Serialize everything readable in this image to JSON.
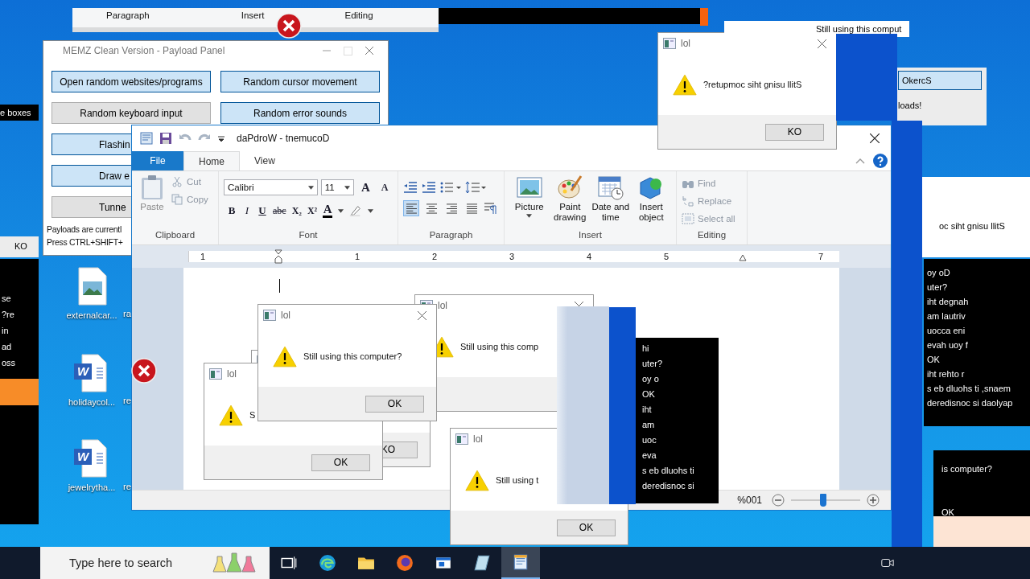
{
  "desktop_icons": [
    {
      "label": "externalcar...",
      "kind": "image"
    },
    {
      "label": "holidaycol...",
      "kind": "word",
      "badge": "W"
    },
    {
      "label": "jewelrytha...",
      "kind": "word",
      "badge": "W"
    }
  ],
  "desktop_label_fragments": [
    "ra",
    "re",
    "re"
  ],
  "memz_panel": {
    "title": "MEMZ Clean Version - Payload Panel",
    "buttons": [
      {
        "label": "Open random websites/programs",
        "on": true
      },
      {
        "label": "Random cursor movement",
        "on": true
      },
      {
        "label": "Random keyboard input",
        "on": false
      },
      {
        "label": "Random error sounds",
        "on": true
      }
    ],
    "partial_buttons": [
      {
        "label": "Flashin",
        "on": true
      },
      {
        "label": "Draw e",
        "on": true
      },
      {
        "label": "Tunne",
        "on": false
      }
    ],
    "status_lines": [
      "Payloads are currentl",
      "Press CTRL+SHIFT+"
    ]
  },
  "wordpad": {
    "title": "daPdroW - tnemucoD",
    "tabs": [
      {
        "label": "File",
        "kind": "file",
        "selected": false
      },
      {
        "label": "Home",
        "kind": "tab",
        "selected": true
      },
      {
        "label": "View",
        "kind": "tab",
        "selected": false
      }
    ],
    "clipboard": {
      "label": "Clipboard",
      "paste": "Paste",
      "small": [
        "Cut",
        "Copy"
      ]
    },
    "font": {
      "label": "Font",
      "family": "Calibri",
      "size": "11",
      "size_buttons": [
        "A",
        "A"
      ],
      "format_buttons": [
        "B",
        "I",
        "U",
        "abc",
        "X₂",
        "X²"
      ],
      "color_glyph": "A"
    },
    "paragraph": {
      "label": "Paragraph",
      "alignments": [
        {
          "selected": true
        },
        {
          "selected": false
        },
        {
          "selected": false
        },
        {
          "selected": false
        }
      ]
    },
    "insert": {
      "label": "Insert",
      "items": [
        {
          "label": "Picture",
          "kind": "picture"
        },
        {
          "label": "Paint drawing",
          "kind": "paint"
        },
        {
          "label": "Date and time",
          "kind": "date"
        },
        {
          "label": "Insert object",
          "kind": "object"
        }
      ]
    },
    "editing": {
      "label": "Editing",
      "items": [
        {
          "label": "Find",
          "kind": "find"
        },
        {
          "label": "Replace",
          "kind": "replace"
        },
        {
          "label": "Select all",
          "kind": "select"
        }
      ]
    },
    "ruler_numbers": [
      "1",
      "1",
      "2",
      "3",
      "4",
      "5",
      "7"
    ],
    "zoom_reading": "%001",
    "zoom": {
      "level": 0.47
    }
  },
  "dialogs": [
    {
      "title": "lol",
      "message": "Still using this comp"
    },
    {
      "button": "KO"
    },
    {
      "title": "lol",
      "message": "S",
      "button": "OK"
    },
    {
      "title": "lol",
      "message": "Still using this computer?",
      "button": "OK"
    },
    {
      "title": "lol",
      "message": "Still using t",
      "button": "OK"
    },
    {
      "title": "lol",
      "message": "?retupmoc siht gnisu llitS",
      "button": "KO"
    }
  ],
  "glitch_fragments": [
    {
      "kind": "ribbon",
      "lines": [
        "Paragraph",
        "Insert",
        "Editing"
      ]
    },
    {
      "kind": "white",
      "lines": [
        "Still using this comput"
      ]
    },
    {
      "kind": "dark",
      "lines": [
        "e boxes"
      ]
    },
    {
      "kind": "light",
      "lines": [
        "KO"
      ]
    },
    {
      "kind": "dark",
      "lines": [
        "se",
        "?re",
        "in",
        "ad",
        "oss"
      ]
    },
    {
      "kind": "light",
      "lines": [
        "OkercS",
        "loads!"
      ]
    },
    {
      "kind": "white",
      "lines": [
        "oc siht gnisu llitS"
      ]
    },
    {
      "kind": "dark",
      "lines": [
        "oy oD",
        "uter?",
        "iht degnah",
        "am lautriv",
        "uocca eni",
        "evah uoy f",
        "OK",
        "iht rehto r",
        "s eb dluohs ti ,snaem",
        "deredisnoc si daolyap"
      ]
    },
    {
      "kind": "dark",
      "lines": [
        "is computer?",
        "OK"
      ]
    },
    {
      "kind": "dark",
      "lines": [
        "hi",
        "uter?",
        "oy o",
        "OK",
        "iht",
        "am",
        "uoc",
        "eva",
        "s eb dluohs ti",
        "deredisnoc si"
      ]
    },
    {
      "kind": "panel"
    },
    {
      "kind": "blue"
    },
    {
      "kind": "blue"
    },
    {
      "kind": "blue"
    },
    {
      "kind": "dark"
    },
    {
      "kind": "orange"
    }
  ],
  "taskbar": {
    "search": {
      "placeholder": "Type here to search"
    },
    "apps": [
      {
        "kind": "taskview",
        "selected": false
      },
      {
        "kind": "edge",
        "selected": false
      },
      {
        "kind": "folder",
        "selected": false
      },
      {
        "kind": "firefox",
        "selected": false
      },
      {
        "kind": "window",
        "selected": false
      },
      {
        "kind": "paper",
        "selected": false
      },
      {
        "kind": "wordpad",
        "selected": true
      }
    ]
  }
}
